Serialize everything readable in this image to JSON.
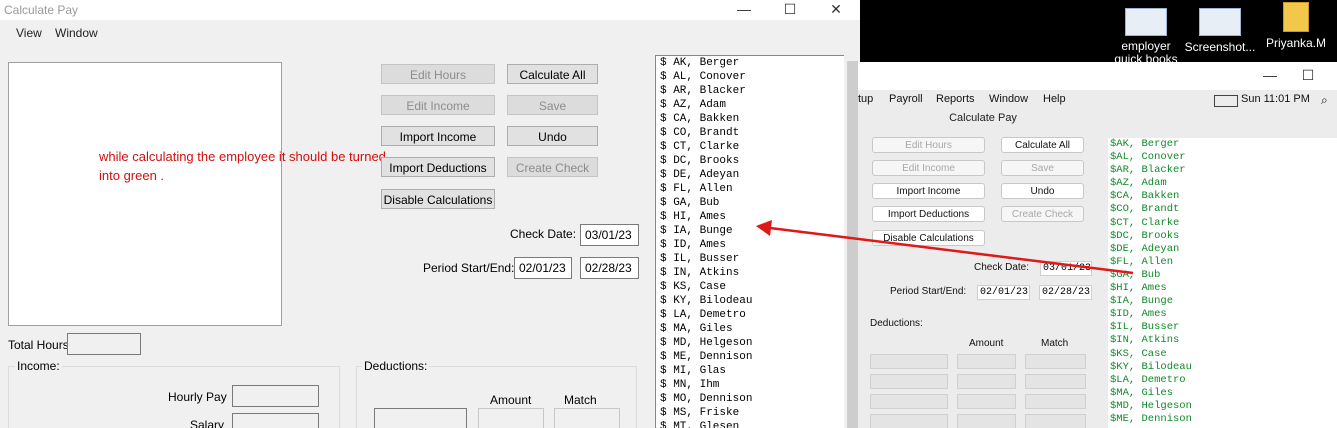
{
  "left_window": {
    "title": "Calculate Pay",
    "controls": {
      "minimize": "—",
      "maximize": "☐",
      "close": "✕"
    },
    "menu": [
      "View",
      "Window"
    ],
    "buttons": {
      "edit_hours": "Edit Hours",
      "calculate_all": "Calculate All",
      "edit_income": "Edit Income",
      "save": "Save",
      "import_income": "Import Income",
      "undo": "Undo",
      "import_deductions": "Import Deductions",
      "create_check": "Create Check",
      "disable_calculations": "Disable Calculations"
    },
    "annotation": "while calculating the employee it should be turned into green .",
    "check_date_label": "Check Date:",
    "check_date": "03/01/23",
    "period_label": "Period Start/End:",
    "period_start": "02/01/23",
    "period_end": "02/28/23",
    "total_hours_label": "Total Hours",
    "income_label": "Income:",
    "hourly_pay_label": "Hourly Pay",
    "salary_label": "Salary",
    "deductions_label": "Deductions:",
    "amount_label": "Amount",
    "match_label": "Match",
    "employees": [
      "$ AK, Berger",
      "$ AL, Conover",
      "$ AR, Blacker",
      "$ AZ, Adam",
      "$ CA, Bakken",
      "$ CO, Brandt",
      "$ CT, Clarke",
      "$ DC, Brooks",
      "$ DE, Adeyan",
      "$ FL, Allen",
      "$ GA, Bub",
      "$ HI, Ames",
      "$ IA, Bunge",
      "$ ID, Ames",
      "$ IL, Busser",
      "$ IN, Atkins",
      "$ KS, Case",
      "$ KY, Bilodeau",
      "$ LA, Demetro",
      "$ MA, Giles",
      "$ MD, Helgeson",
      "$ ME, Dennison",
      "$ MI, Glas",
      "$ MN, Ihm",
      "$ MO, Dennison",
      "$ MS, Friske",
      "$ MT, Glesen"
    ]
  },
  "desktop": {
    "icons": [
      {
        "name": "employer",
        "label": "employer\nquick books"
      },
      {
        "name": "screenshot",
        "label": "Screenshot..."
      },
      {
        "name": "folder",
        "label": "Priyanka.M"
      }
    ]
  },
  "right_window": {
    "controls": {
      "minimize": "—",
      "maximize": "☐"
    },
    "menu": [
      "tup",
      "Payroll",
      "Reports",
      "Window",
      "Help"
    ],
    "clock": "Sun 11:01 PM",
    "title": "Calculate Pay",
    "buttons": {
      "edit_hours": "Edit Hours",
      "calculate_all": "Calculate All",
      "edit_income": "Edit Income",
      "save": "Save",
      "import_income": "Import Income",
      "undo": "Undo",
      "import_deductions": "Import Deductions",
      "create_check": "Create Check",
      "disable_calculations": "Disable Calculations"
    },
    "check_date_label": "Check Date:",
    "check_date": "03/01/23",
    "period_label": "Period Start/End:",
    "period_start": "02/01/23",
    "period_end": "02/28/23",
    "deductions_label": "Deductions:",
    "amount_label": "Amount",
    "match_label": "Match",
    "employees": [
      "$AK, Berger",
      "$AL, Conover",
      "$AR, Blacker",
      "$AZ, Adam",
      "$CA, Bakken",
      "$CO, Brandt",
      "$CT, Clarke",
      "$DC, Brooks",
      "$DE, Adeyan",
      "$FL, Allen",
      "$GA, Bub",
      "$HI, Ames",
      "$IA, Bunge",
      "$ID, Ames",
      "$IL, Busser",
      "$IN, Atkins",
      "$KS, Case",
      "$KY, Bilodeau",
      "$LA, Demetro",
      "$MA, Giles",
      "$MD, Helgeson",
      "$ME, Dennison"
    ],
    "list_color": "#0f8a2a"
  },
  "colors": {
    "annotation": "#d01010",
    "arrow": "#e01818"
  }
}
